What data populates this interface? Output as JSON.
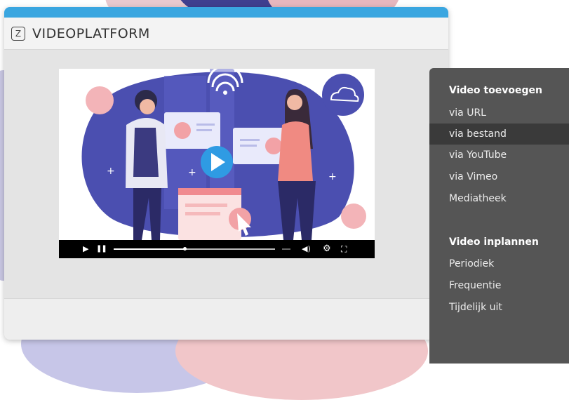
{
  "app": {
    "logo_letter": "Z",
    "title": "VIDEOPLATFORM"
  },
  "colors": {
    "accent": "#3aa6e0",
    "menu_background": "#555555",
    "menu_active": "#3a3a3a"
  },
  "video_player": {
    "progress": 0.44,
    "icons": [
      "play-icon",
      "pause-icon",
      "volume-icon",
      "settings-icon",
      "fullscreen-icon"
    ]
  },
  "menu": {
    "sections": [
      {
        "heading": "Video toevoegen",
        "items": [
          {
            "label": "via URL",
            "active": false
          },
          {
            "label": "via bestand",
            "active": true
          },
          {
            "label": "via YouTube",
            "active": false
          },
          {
            "label": "via Vimeo",
            "active": false
          },
          {
            "label": "Mediatheek",
            "active": false
          }
        ]
      },
      {
        "heading": "Video inplannen",
        "items": [
          {
            "label": "Periodiek",
            "active": false
          },
          {
            "label": "Frequentie",
            "active": false
          },
          {
            "label": "Tijdelijk uit",
            "active": false
          }
        ]
      }
    ]
  }
}
